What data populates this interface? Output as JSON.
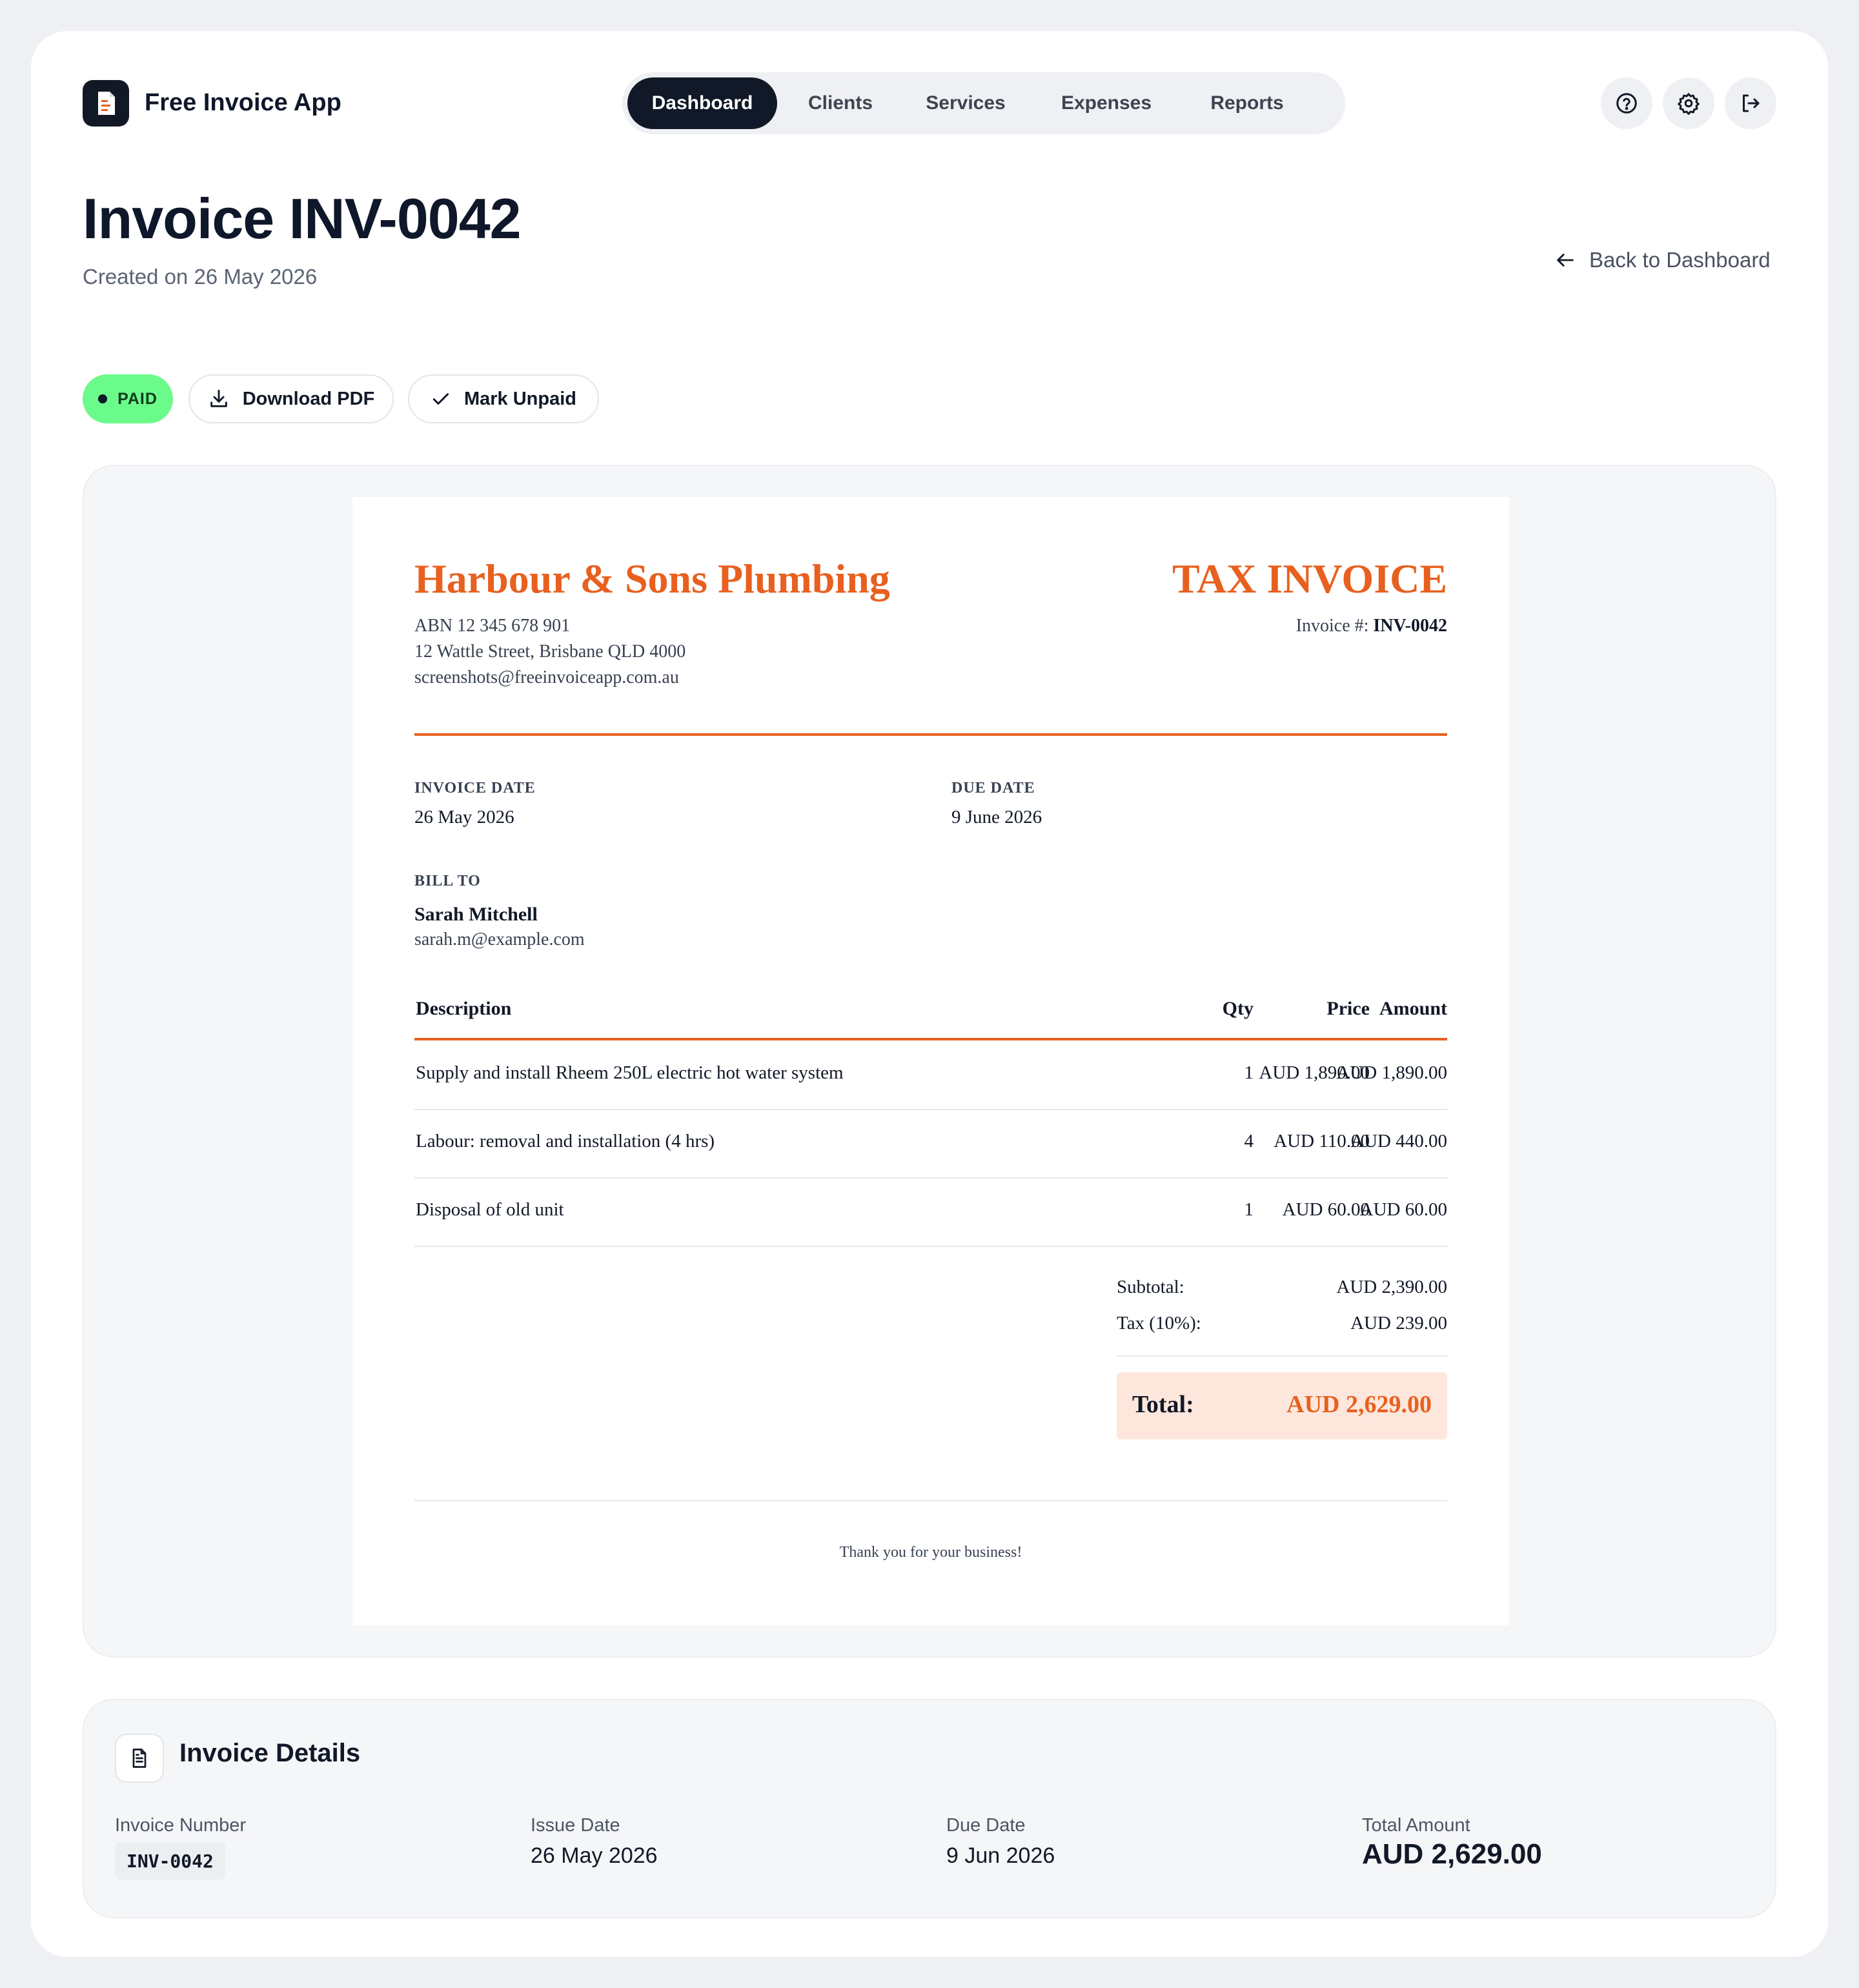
{
  "app": {
    "name": "Free Invoice App"
  },
  "nav": {
    "items": [
      "Dashboard",
      "Clients",
      "Services",
      "Expenses",
      "Reports"
    ],
    "active": "Dashboard"
  },
  "header_icons": [
    "help-icon",
    "settings-icon",
    "logout-icon"
  ],
  "page": {
    "title": "Invoice INV-0042",
    "created": "Created on 26 May 2026",
    "back_label": "Back to Dashboard"
  },
  "actions": {
    "status": "PAID",
    "download_label": "Download PDF",
    "mark_label": "Mark Unpaid"
  },
  "invoice": {
    "business_name": "Harbour & Sons Plumbing",
    "abn": "ABN 12 345 678 901",
    "address": "12 Wattle Street, Brisbane QLD 4000",
    "email": "screenshots@freeinvoiceapp.com.au",
    "doc_title": "TAX INVOICE",
    "number_label": "Invoice #:",
    "number": "INV-0042",
    "invoice_date_label": "INVOICE DATE",
    "invoice_date": "26 May 2026",
    "due_date_label": "DUE DATE",
    "due_date": "9 June 2026",
    "bill_to_label": "BILL TO",
    "client_name": "Sarah Mitchell",
    "client_email": "sarah.m@example.com",
    "columns": [
      "Description",
      "Qty",
      "Price",
      "Amount"
    ],
    "lines": [
      {
        "description": "Supply and install Rheem 250L electric hot water system",
        "qty": "1",
        "price": "AUD 1,890.00",
        "amount": "AUD 1,890.00"
      },
      {
        "description": "Labour: removal and installation (4 hrs)",
        "qty": "4",
        "price": "AUD 110.00",
        "amount": "AUD 440.00"
      },
      {
        "description": "Disposal of old unit",
        "qty": "1",
        "price": "AUD 60.00",
        "amount": "AUD 60.00"
      }
    ],
    "subtotal_label": "Subtotal:",
    "subtotal": "AUD 2,390.00",
    "tax_label": "Tax (10%):",
    "tax": "AUD 239.00",
    "total_label": "Total:",
    "total": "AUD 2,629.00",
    "thanks": "Thank you for your business!"
  },
  "details": {
    "title": "Invoice Details",
    "invoice_number_label": "Invoice Number",
    "invoice_number": "INV-0042",
    "issue_date_label": "Issue Date",
    "issue_date": "26 May 2026",
    "due_date_label": "Due Date",
    "due_date": "9 Jun 2026",
    "total_label": "Total Amount",
    "total": "AUD 2,629.00"
  },
  "colors": {
    "accent": "#e8601f",
    "paid": "#6bfb8b",
    "dark": "#111827",
    "background": "#eff0f3",
    "total_bg": "#fde7dc"
  }
}
